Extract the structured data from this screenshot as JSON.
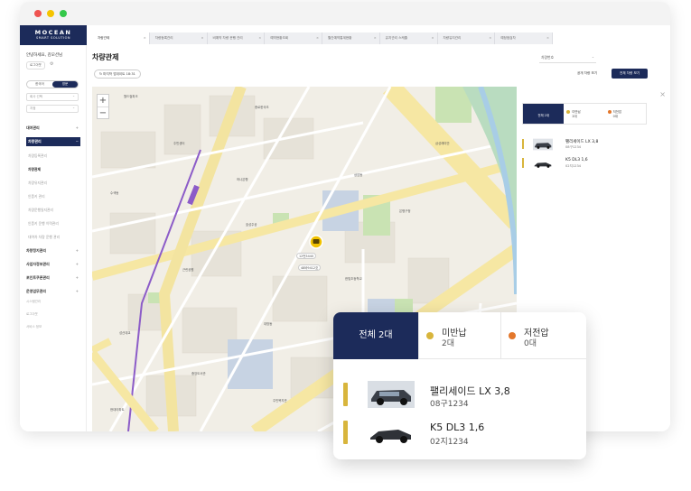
{
  "brand": {
    "name": "MOCEAN",
    "sub": "SMART SOLUTION"
  },
  "user": {
    "greeting": "안녕하세요, 김모션님",
    "logout": "로그아웃"
  },
  "sidebar": {
    "toggle": [
      "한국어",
      "영문"
    ],
    "select_company": "회사 선택",
    "select_branch": "지점",
    "menus": [
      {
        "label": "대여관리",
        "sign": "+"
      },
      {
        "label": "차량관리",
        "sign": "−"
      }
    ],
    "submenus": [
      "차량등록관리",
      "차량관제",
      "차량유지관리",
      "인증키 관리",
      "차량운행일지관리",
      "인증키 운행 이력관리",
      "대여차 차량 운행 관리"
    ],
    "menus_after": [
      {
        "label": "차량정지관리",
        "sign": "+"
      },
      {
        "label": "사업자정보관리",
        "sign": "+"
      },
      {
        "label": "포인트쿠폰관리",
        "sign": "+"
      },
      {
        "label": "운영업무관리",
        "sign": "+"
      }
    ],
    "footer": [
      "시스템관리",
      "로그아웃",
      "서비스 정보"
    ]
  },
  "tabs": [
    "차량관제",
    "차량등록관리",
    "비예약 차량 운행 관리",
    "예약현황조회",
    "월간예약통계현황",
    "유지관리 스케줄",
    "차량유지관리",
    "예정점검차"
  ],
  "page": {
    "title": "차량관제",
    "type_select": "차량번호",
    "refresh": "마지막 업데이트 18:31",
    "btn_link": "공개 차량 보기",
    "btn_all": "전체 차량 보기"
  },
  "map_labels": {
    "marker_top": "12번3440",
    "marker_bottom": "48바9412호",
    "places": [
      "월드컵파크",
      "종로한국초",
      "주민센터",
      "하나은행",
      "상암동",
      "수색동",
      "효성주공",
      "은평구청",
      "근린공원",
      "성산대교",
      "대방동",
      "한빛초등학교",
      "중앙도서관",
      "주민복지관",
      "삼성래미안",
      "현대아파트"
    ]
  },
  "panel": {
    "summary": [
      {
        "label": "전체 2대",
        "count": ""
      },
      {
        "label": "미반납",
        "count": "2대",
        "color": "#d8b53c"
      },
      {
        "label": "저전압",
        "count": "0대",
        "color": "#e3772b"
      }
    ],
    "vehicles": [
      {
        "name": "팰리세이드 LX 3,8",
        "plate": "08구1234"
      },
      {
        "name": "K5 DL3 1,6",
        "plate": "02지1234"
      }
    ]
  },
  "colors": {
    "navy": "#1c2b5a",
    "unreturned": "#d8b53c",
    "lowvoltage": "#e3772b"
  }
}
